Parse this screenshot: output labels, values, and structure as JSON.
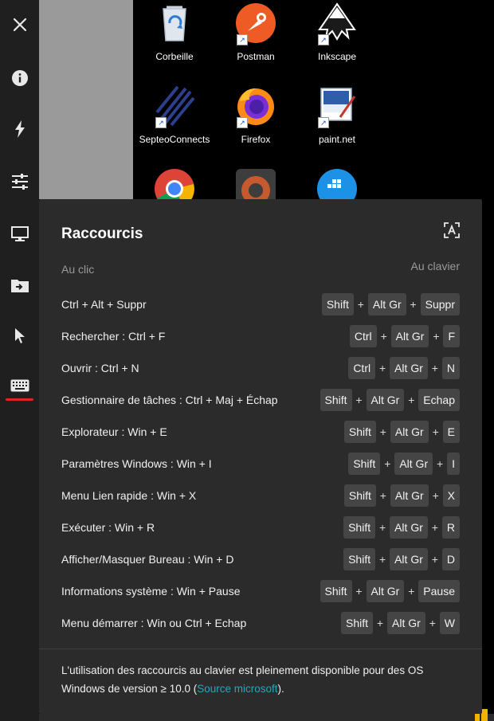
{
  "toolbar": {
    "items": [
      {
        "name": "close-icon"
      },
      {
        "name": "info-icon"
      },
      {
        "name": "lightning-icon"
      },
      {
        "name": "sliders-icon"
      },
      {
        "name": "monitor-icon"
      },
      {
        "name": "file-transfer-icon"
      },
      {
        "name": "cursor-icon"
      },
      {
        "name": "keyboard-icon",
        "active": true
      }
    ],
    "accent_color": "#e0222d"
  },
  "desktop": {
    "icons": [
      {
        "label": "Corbeille"
      },
      {
        "label": "Postman"
      },
      {
        "label": "Inkscape"
      },
      {
        "label": "SepteoConnects"
      },
      {
        "label": "Firefox"
      },
      {
        "label": "paint.net"
      },
      {
        "label": ""
      },
      {
        "label": ""
      },
      {
        "label": ""
      }
    ]
  },
  "panel": {
    "title": "Raccourcis",
    "col_left": "Au clic",
    "col_right": "Au clavier",
    "shortcuts": [
      {
        "label": "Ctrl + Alt + Suppr",
        "keys": [
          "Shift",
          "Alt Gr",
          "Suppr"
        ]
      },
      {
        "label": "Rechercher : Ctrl + F",
        "keys": [
          "Ctrl",
          "Alt Gr",
          "F"
        ]
      },
      {
        "label": "Ouvrir : Ctrl + N",
        "keys": [
          "Ctrl",
          "Alt Gr",
          "N"
        ]
      },
      {
        "label": "Gestionnaire de tâches : Ctrl + Maj + Échap",
        "keys": [
          "Shift",
          "Alt Gr",
          "Echap"
        ]
      },
      {
        "label": "Explorateur : Win + E",
        "keys": [
          "Shift",
          "Alt Gr",
          "E"
        ]
      },
      {
        "label": "Paramètres Windows : Win + I",
        "keys": [
          "Shift",
          "Alt Gr",
          "I"
        ]
      },
      {
        "label": "Menu Lien rapide : Win + X",
        "keys": [
          "Shift",
          "Alt Gr",
          "X"
        ]
      },
      {
        "label": "Exécuter : Win + R",
        "keys": [
          "Shift",
          "Alt Gr",
          "R"
        ]
      },
      {
        "label": "Afficher/Masquer Bureau : Win + D",
        "keys": [
          "Shift",
          "Alt Gr",
          "D"
        ]
      },
      {
        "label": "Informations système : Win + Pause",
        "keys": [
          "Shift",
          "Alt Gr",
          "Pause"
        ]
      },
      {
        "label": "Menu démarrer : Win ou Ctrl + Echap",
        "keys": [
          "Shift",
          "Alt Gr",
          "W"
        ]
      }
    ],
    "plus": "+",
    "footnote_text": "L'utilisation des raccourcis au clavier est pleinement disponible pour des OS Windows de version ≥ 10.0 (",
    "footnote_link": "Source microsoft",
    "footnote_end": ").",
    "link_color": "#2aa4bf"
  }
}
